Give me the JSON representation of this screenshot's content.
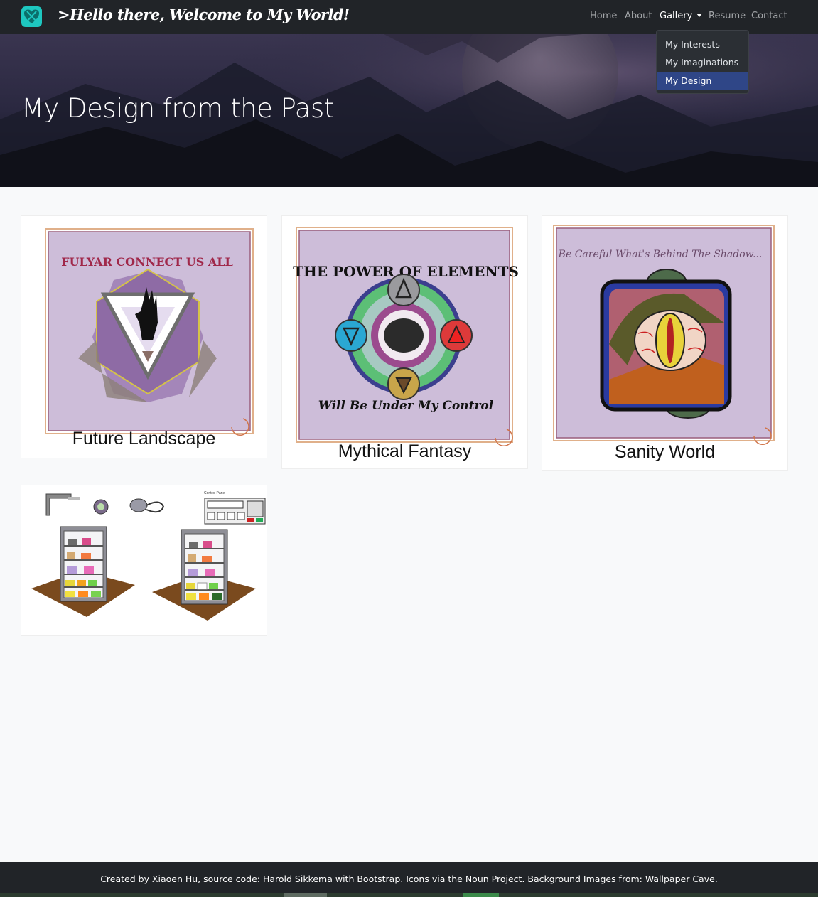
{
  "navbar": {
    "brand": ">Hello there, Welcome to My World!",
    "links": [
      {
        "label": "Home"
      },
      {
        "label": "About"
      },
      {
        "label": "Gallery"
      },
      {
        "label": "Resume"
      },
      {
        "label": "Contact"
      }
    ],
    "active_link": "Gallery",
    "brand_icon": "teal-heart-logo-icon"
  },
  "dropdown": {
    "items": [
      {
        "label": "My Interests"
      },
      {
        "label": "My Imaginations"
      },
      {
        "label": "My Design"
      }
    ],
    "active_item": "My Design"
  },
  "hero": {
    "title": "My Design from the Past"
  },
  "gallery": {
    "cards": [
      {
        "caption": "Future Landscape",
        "poster_text": "FULYAR CONNECT US ALL"
      },
      {
        "caption": "Mythical Fantasy",
        "poster_text_top": "THE POWER OF ELEMENTS",
        "poster_text_bottom": "Will Be Under My Control"
      },
      {
        "caption": "Sanity World",
        "poster_text": "Be Careful What's Behind The Shadow..."
      },
      {
        "caption": "",
        "poster_text": "Control Panel"
      }
    ]
  },
  "footer": {
    "prefix": "Created by Xiaoen Hu, source code: ",
    "link1": "Harold Sikkema",
    "mid1": " with ",
    "link2": "Bootstrap",
    "mid2": ". Icons via the ",
    "link3": "Noun Project",
    "mid3": ". Background Images from: ",
    "link4": "Wallpaper Cave",
    "suffix": "."
  },
  "colors": {
    "navbar_bg": "#212428",
    "dropdown_active": "#2f4687",
    "page_bg": "#f8f9fa",
    "poster_bg": "#cdbdd9",
    "brand_icon": "#1ec7c0"
  }
}
